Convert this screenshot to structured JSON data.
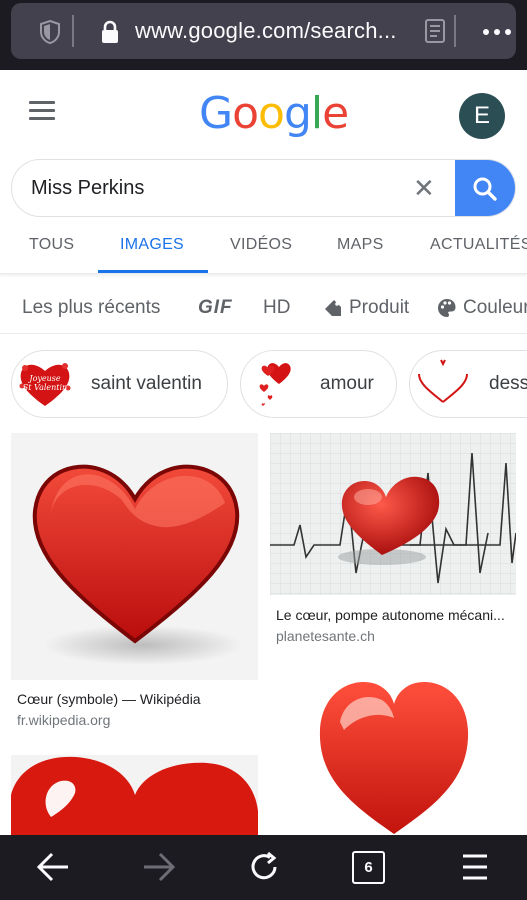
{
  "browser": {
    "url": "www.google.com/search...",
    "tab_count": "6"
  },
  "header": {
    "logo_letters": [
      "G",
      "o",
      "o",
      "g",
      "l",
      "e"
    ],
    "avatar_initial": "E"
  },
  "search": {
    "query": "Miss Perkins",
    "clear_glyph": "✕"
  },
  "tabs": [
    "TOUS",
    "IMAGES",
    "VIDÉOS",
    "MAPS",
    "ACTUALITÉS"
  ],
  "active_tab": "IMAGES",
  "filters": {
    "recent": "Les plus récents",
    "gif": "GIF",
    "hd": "HD",
    "product": "Produit",
    "color": "Couleur"
  },
  "chips": [
    {
      "label": "saint valentin",
      "thumb_text": "Joyeuse St Valentin"
    },
    {
      "label": "amour"
    },
    {
      "label": "dessin"
    }
  ],
  "results": [
    {
      "title": "Cœur (symbole) — Wikipédia",
      "source": "fr.wikipedia.org"
    },
    {
      "title": "Le cœur, pompe autonome mécani...",
      "source": "planetesante.ch"
    },
    {
      "title": "",
      "source": ""
    },
    {
      "title": "",
      "source": ""
    }
  ],
  "colors": {
    "accent": "#1a73e8",
    "search_button": "#4285F4",
    "browser_chrome": "#1c1b22",
    "heart_red": "#e0221a"
  }
}
